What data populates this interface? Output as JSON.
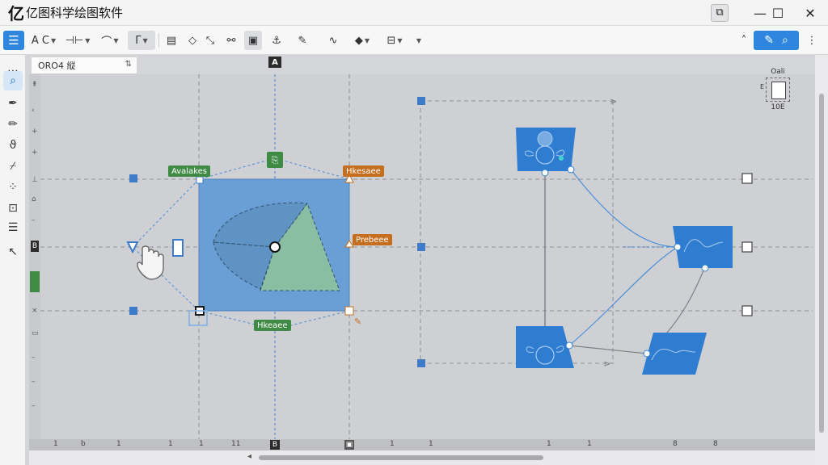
{
  "app": {
    "logo": "亿",
    "title": "亿图科学绘图软件"
  },
  "window_controls": {
    "pin": "⧉",
    "minimize": "—",
    "maximize": "☐",
    "close": "✕"
  },
  "toolbar": {
    "menu_icon": "☰",
    "text_style": "A C",
    "font_size_icon": "⊣⊢",
    "connector_icon": "⌒",
    "line_icon": "Γ",
    "accent": "#2e86de"
  },
  "search": {
    "value": "ORO4 縦",
    "sort_icon": "⇅"
  },
  "rulers": {
    "top_marker": "A",
    "left_marker": "B",
    "bottom_marker": "B",
    "bottom_labels": [
      "1",
      "b",
      "1",
      "1",
      "1",
      "11",
      "1",
      "1",
      "1",
      "1",
      "8",
      "8"
    ]
  },
  "shape_info": {
    "top": "Oali",
    "left": "E",
    "bottom": "10E"
  },
  "tags": {
    "top_left": "Avalakes",
    "top_right": "Hkesaee",
    "right": "Prebeee",
    "bottom": "Hkeaee"
  },
  "colors": {
    "canvas_bg": "#cfd0d4",
    "shape_blue": "#2e7dd1",
    "square_fill": "#6a9fd6",
    "sector_green": "#7fb08a",
    "tag_green": "#3f8a45",
    "tag_orange": "#c66d1e"
  }
}
